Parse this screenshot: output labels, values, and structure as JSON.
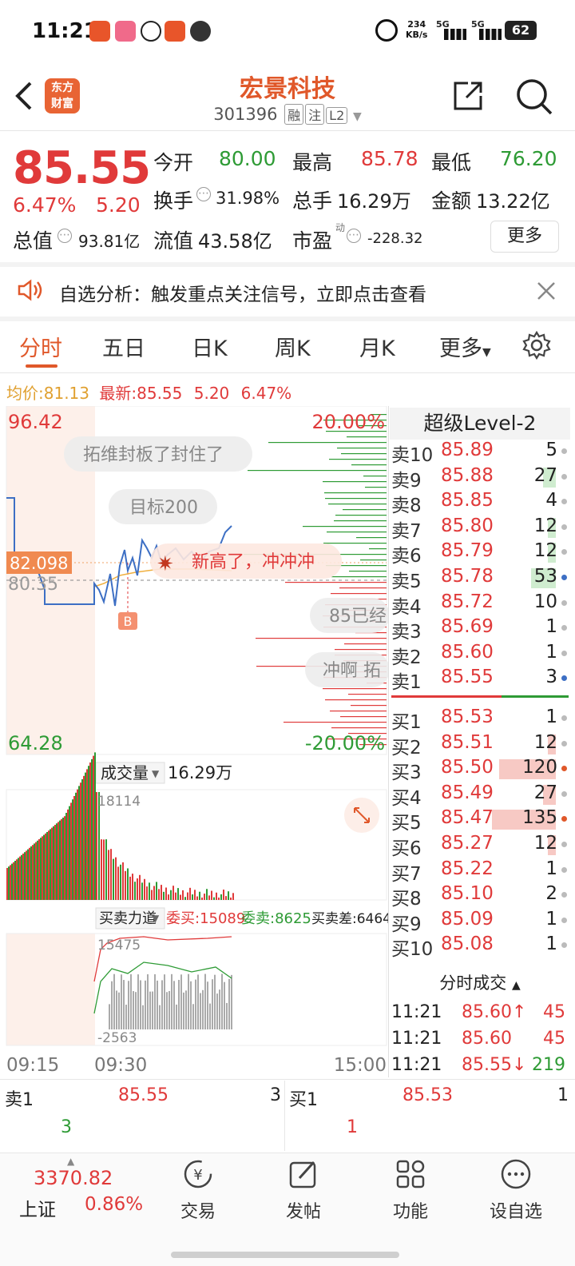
{
  "status_bar": {
    "time": "11:21",
    "net_speed": "234\nKB/s",
    "net_speed_top": "234",
    "net_speed_unit": "KB/s",
    "sim1": "5G",
    "sim2": "5G",
    "battery": "62"
  },
  "header": {
    "title": "宏景科技",
    "code": "301396",
    "tags": [
      "融",
      "注",
      "L2"
    ],
    "logo_line1": "东方",
    "logo_line2": "财富"
  },
  "quote": {
    "price": "85.55",
    "change_pct": "6.47%",
    "change": "5.20",
    "open_label": "今开",
    "open": "80.00",
    "high_label": "最高",
    "high": "85.78",
    "low_label": "最低",
    "low": "76.20",
    "turnover_label": "换手",
    "turnover": "31.98%",
    "volume_label": "总手",
    "volume": "16.29万",
    "amount_label": "金额",
    "amount": "13.22亿",
    "mktcap_label": "总值",
    "mktcap": "93.81亿",
    "float_label": "流值",
    "float_cap": "43.58亿",
    "pe_label": "市盈",
    "pe_sup": "动",
    "pe": "-228.32",
    "more": "更多"
  },
  "notice": {
    "text": "自选分析：触发重点关注信号，立即点击查看"
  },
  "tabs": [
    "分时",
    "五日",
    "日K",
    "周K",
    "月K",
    "更多"
  ],
  "avg_line": {
    "avg_label": "均价:",
    "avg": "81.13",
    "last_label": "最新:",
    "last": "85.55",
    "chg": "5.20",
    "pct": "6.47%"
  },
  "chart": {
    "ymax": "96.42",
    "ymin": "64.28",
    "pct_top": "20.00%",
    "pct_bottom": "-20.00%",
    "mid": "80.35",
    "cursor_price": "82.098",
    "b_marker": "B",
    "comments": [
      "拓维封板了封住了",
      "目标200",
      "新高了，冲冲冲",
      "85已经",
      "冲啊 拓"
    ],
    "volume_label": "成交量",
    "volume_total": "16.29万",
    "vol_max": "18114",
    "force_label": "买卖力道",
    "buy_label": "委买:15089",
    "sell_label": "委卖:8625",
    "diff_label": "买卖差:6464",
    "force_top": "15475",
    "force_bottom": "-2563",
    "times": [
      "09:15",
      "09:30",
      "15:00"
    ]
  },
  "level2": {
    "title": "超级Level-2"
  },
  "sells": [
    {
      "label": "卖10",
      "price": "85.89",
      "vol": "5",
      "bar": 0
    },
    {
      "label": "卖9",
      "price": "85.88",
      "vol": "27",
      "bar": 0.2
    },
    {
      "label": "卖8",
      "price": "85.85",
      "vol": "4",
      "bar": 0
    },
    {
      "label": "卖7",
      "price": "85.80",
      "vol": "12",
      "bar": 0.09
    },
    {
      "label": "卖6",
      "price": "85.79",
      "vol": "12",
      "bar": 0.09
    },
    {
      "label": "卖5",
      "price": "85.78",
      "vol": "53",
      "bar": 0.39
    },
    {
      "label": "卖4",
      "price": "85.72",
      "vol": "10",
      "bar": 0
    },
    {
      "label": "卖3",
      "price": "85.69",
      "vol": "1",
      "bar": 0
    },
    {
      "label": "卖2",
      "price": "85.60",
      "vol": "1",
      "bar": 0
    },
    {
      "label": "卖1",
      "price": "85.55",
      "vol": "3",
      "bar": 0
    }
  ],
  "buys": [
    {
      "label": "买1",
      "price": "85.53",
      "vol": "1",
      "bar": 0
    },
    {
      "label": "买2",
      "price": "85.51",
      "vol": "12",
      "bar": 0.09
    },
    {
      "label": "买3",
      "price": "85.50",
      "vol": "120",
      "bar": 0.89
    },
    {
      "label": "买4",
      "price": "85.49",
      "vol": "27",
      "bar": 0.2
    },
    {
      "label": "买5",
      "price": "85.47",
      "vol": "135",
      "bar": 1
    },
    {
      "label": "买6",
      "price": "85.27",
      "vol": "12",
      "bar": 0.09
    },
    {
      "label": "买7",
      "price": "85.22",
      "vol": "1",
      "bar": 0
    },
    {
      "label": "买8",
      "price": "85.10",
      "vol": "2",
      "bar": 0
    },
    {
      "label": "买9",
      "price": "85.09",
      "vol": "1",
      "bar": 0
    },
    {
      "label": "买10",
      "price": "85.08",
      "vol": "1",
      "bar": 0
    }
  ],
  "ticks": {
    "title": "分时成交",
    "rows": [
      {
        "time": "11:21",
        "price": "85.60↑",
        "vol": "45"
      },
      {
        "time": "11:21",
        "price": "85.60",
        "vol": "45"
      },
      {
        "time": "11:21",
        "price": "85.55↓",
        "vol": "219"
      }
    ]
  },
  "bottom_bar": {
    "sell_label": "卖1",
    "sell_price": "85.55",
    "sell_vol": "3",
    "sell_count": "3",
    "buy_label": "买1",
    "buy_price": "85.53",
    "buy_vol": "1",
    "buy_count": "1"
  },
  "nav": {
    "index_value": "3370.82",
    "index_name": "上证",
    "index_pct": "0.86%",
    "items": [
      "交易",
      "发帖",
      "功能",
      "设自选"
    ]
  },
  "colors": {
    "accent": "#e0582a",
    "up": "#e03a3a",
    "down": "#2e9b35",
    "price_line": "#3d6fc4"
  }
}
